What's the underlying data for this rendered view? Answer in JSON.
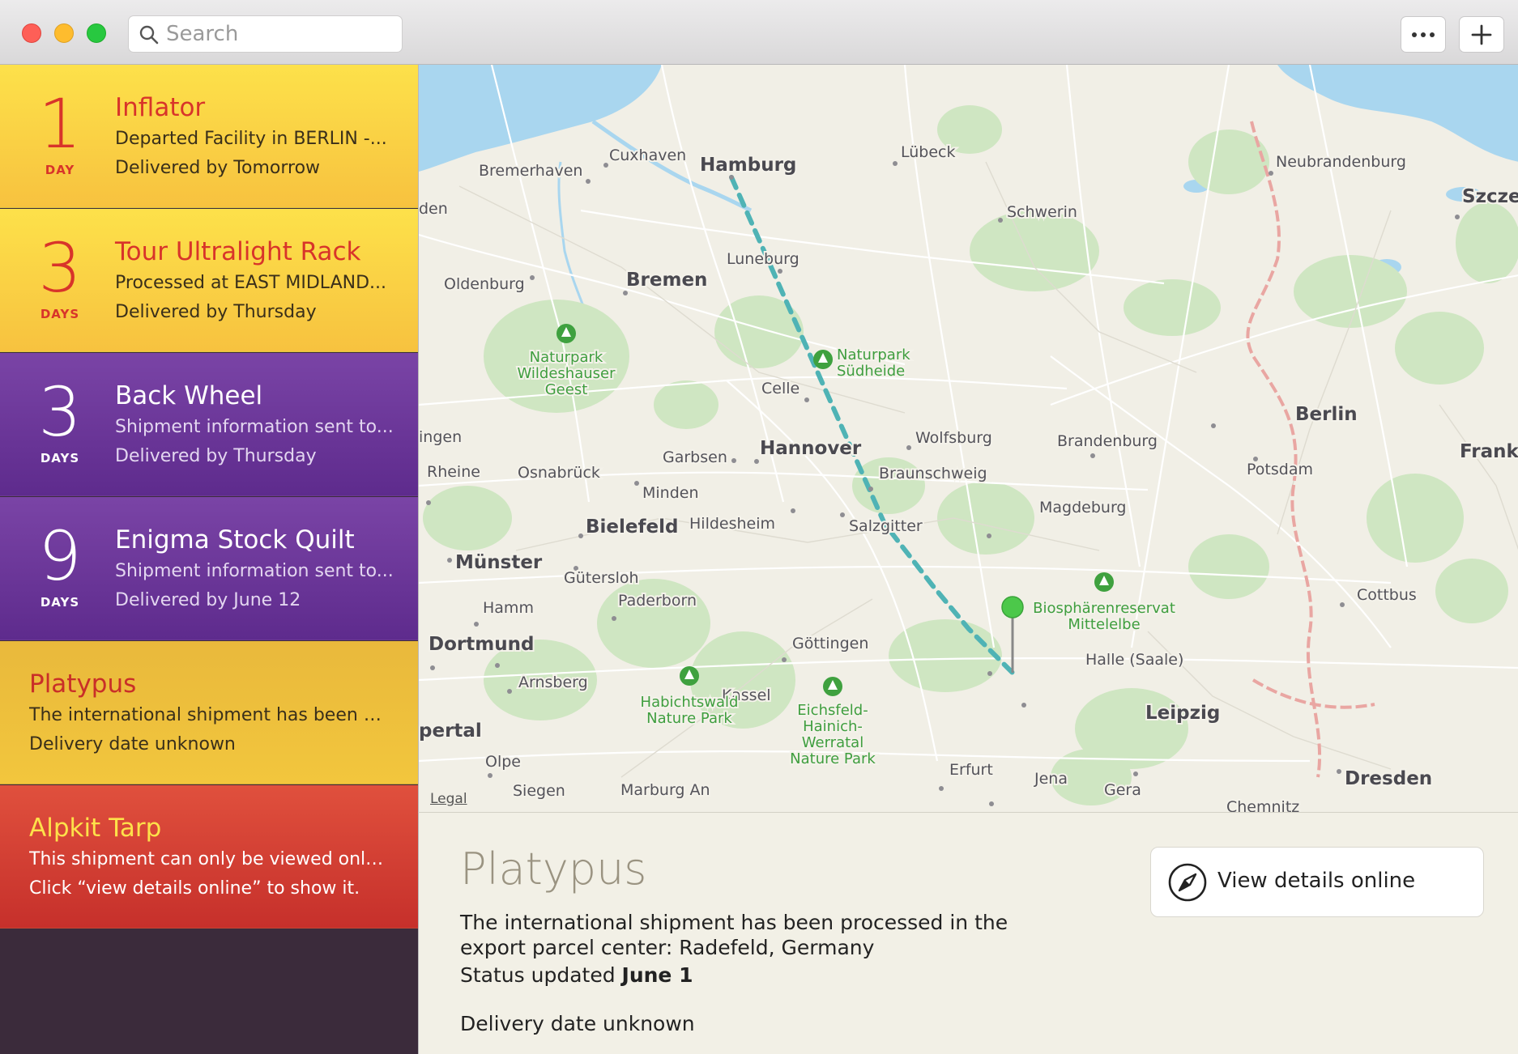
{
  "toolbar": {
    "search_placeholder": "Search",
    "more_icon": "ellipsis-icon",
    "add_icon": "plus-icon"
  },
  "packages": [
    {
      "days": "1",
      "unit": "DAY",
      "title": "Inflator",
      "status": "Departed Facility in BERLIN -...",
      "delivery_prefix": "Delivered by ",
      "delivery_date": "Tomorrow",
      "color": "#fde14a"
    },
    {
      "days": "3",
      "unit": "DAYS",
      "title": "Tour Ultralight Rack",
      "status": "Processed at EAST MIDLAND...",
      "delivery_prefix": "Delivered by ",
      "delivery_date": "Thursday",
      "color": "#fde14a"
    },
    {
      "days": "3",
      "unit": "DAYS",
      "title": "Back Wheel",
      "status": "Shipment information sent to...",
      "delivery_prefix": "Delivered by ",
      "delivery_date": "Thursday",
      "color": "#6a3699"
    },
    {
      "days": "9",
      "unit": "DAYS",
      "title": "Enigma Stock Quilt",
      "status": "Shipment information sent to...",
      "delivery_prefix": "Delivered by ",
      "delivery_date": "June 12",
      "color": "#6a3699"
    },
    {
      "title": "Platypus",
      "status": "The international shipment has been p...",
      "delivery": "Delivery date unknown",
      "color": "#eec03d"
    },
    {
      "title": "Alpkit Tarp",
      "status": "This shipment can only be viewed onli...",
      "delivery": "Click “view details online” to show it.",
      "color": "#d6412f"
    }
  ],
  "map": {
    "legal": "Legal",
    "cities": {
      "cuxhaven": "Cuxhaven",
      "lubeck": "Lübeck",
      "hamburg": "Hamburg",
      "schwerin": "Schwerin",
      "bremerhaven": "Bremerhaven",
      "neubrandenburg": "Neubrandenburg",
      "szcze": "Szcze",
      "den": "den",
      "luneburg": "Luneburg",
      "oldenburg": "Oldenburg",
      "bremen": "Bremen",
      "celle": "Celle",
      "berlin": "Berlin",
      "ingen": "ingen",
      "wolfsburg": "Wolfsburg",
      "brandenburg": "Brandenburg",
      "frankfu": "Frankfu",
      "garbsen": "Garbsen",
      "hannover": "Hannover",
      "rheine": "Rheine",
      "osnabruck": "Osnabrück",
      "braunschweig": "Braunschweig",
      "potsdam": "Potsdam",
      "minden": "Minden",
      "magdeburg": "Magdeburg",
      "bielefeld": "Bielefeld",
      "hildesheim": "Hildesheim",
      "salzgitter": "Salzgitter",
      "munster": "Münster",
      "gutersloh": "Gütersloh",
      "cottbus": "Cottbus",
      "hamm": "Hamm",
      "paderborn": "Paderborn",
      "dortmund": "Dortmund",
      "gottingen": "Göttingen",
      "halle": "Halle (Saale)",
      "arnsberg": "Arnsberg",
      "kassel": "Kassel",
      "leipzig": "Leipzig",
      "pertal": "pertal",
      "olpe": "Olpe",
      "erfurt": "Erfurt",
      "jena": "Jena",
      "dresden": "Dresden",
      "siegen": "Siegen",
      "marburg": "Marburg An",
      "gera": "Gera",
      "chemnitz": "Chemnitz"
    },
    "parks": {
      "wildeshauser_1": "Naturpark",
      "wildeshauser_2": "Wildeshauser",
      "wildeshauser_3": "Geest",
      "sudheide_1": "Naturpark",
      "sudheide_2": "Südheide",
      "mittelelbe_1": "Biosphärenreservat",
      "mittelelbe_2": "Mittelelbe",
      "habichtswald_1": "Habichtswald",
      "habichtswald_2": "Nature Park",
      "eichsfeld_1": "Eichsfeld-",
      "eichsfeld_2": "Hainich-",
      "eichsfeld_3": "Werratal",
      "eichsfeld_4": "Nature Park"
    }
  },
  "detail": {
    "title": "Platypus",
    "status": "The international shipment has been processed in the export parcel center: Radefeld, Germany",
    "updated_prefix": "Status updated ",
    "updated_date": "June 1",
    "delivery": "Delivery date unknown",
    "view_button": "View details online",
    "view_icon": "compass-icon"
  },
  "colors": {
    "yellow": "#fde14a",
    "purple": "#6a3699",
    "gold": "#eec03d",
    "red": "#d6412f",
    "route": "#4fb3b5",
    "pin": "#4cc84a"
  }
}
